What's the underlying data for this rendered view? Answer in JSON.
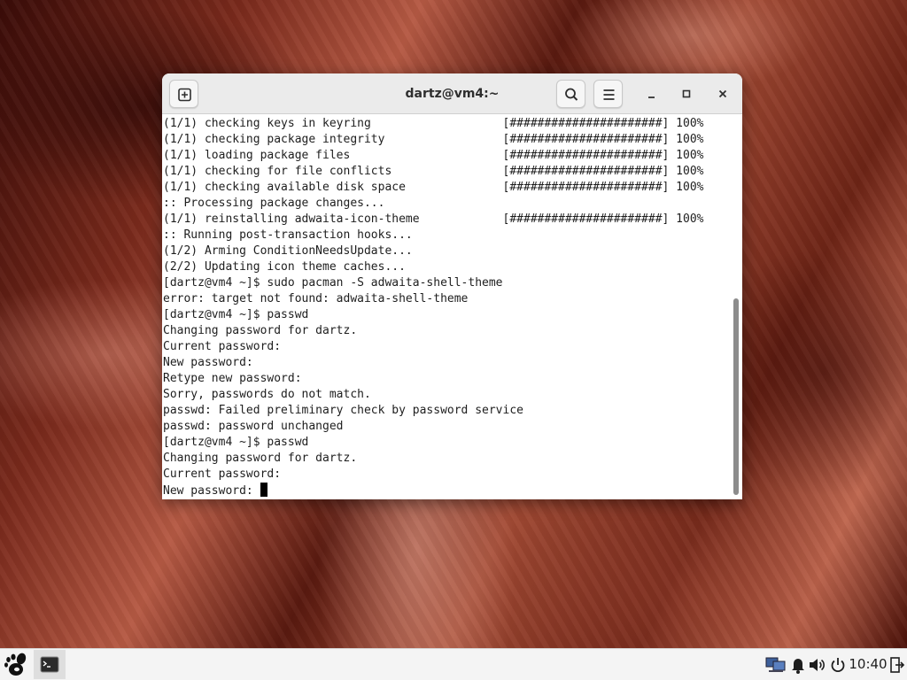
{
  "window": {
    "title": "dartz@vm4:~"
  },
  "terminal": {
    "lines": [
      "(1/1) checking keys in keyring                   [######################] 100%",
      "(1/1) checking package integrity                 [######################] 100%",
      "(1/1) loading package files                      [######################] 100%",
      "(1/1) checking for file conflicts                [######################] 100%",
      "(1/1) checking available disk space              [######################] 100%",
      ":: Processing package changes...",
      "(1/1) reinstalling adwaita-icon-theme            [######################] 100%",
      ":: Running post-transaction hooks...",
      "(1/2) Arming ConditionNeedsUpdate...",
      "(2/2) Updating icon theme caches...",
      "[dartz@vm4 ~]$ sudo pacman -S adwaita-shell-theme",
      "error: target not found: adwaita-shell-theme",
      "[dartz@vm4 ~]$ passwd",
      "Changing password for dartz.",
      "Current password:",
      "New password:",
      "Retype new password:",
      "Sorry, passwords do not match.",
      "passwd: Failed preliminary check by password service",
      "passwd: password unchanged",
      "[dartz@vm4 ~]$ passwd",
      "Changing password for dartz.",
      "Current password:",
      "New password: "
    ]
  },
  "panel": {
    "clock": "10:40"
  },
  "icons": {
    "new_tab": "new-tab-icon",
    "search": "search-icon",
    "menu": "hamburger-menu-icon",
    "minimize": "minimize-icon",
    "maximize": "maximize-icon",
    "close": "close-icon",
    "gnome": "gnome-foot-icon",
    "terminal_app": "terminal-icon",
    "network": "network-icon",
    "bell": "bell-icon",
    "volume": "volume-icon",
    "power": "power-icon",
    "exit": "exit-icon"
  },
  "colors": {
    "terminal_bg": "#ffffff",
    "terminal_fg": "#1e1e1e",
    "titlebar_bg": "#ebebeb",
    "panel_bg": "#f4f4f4"
  }
}
